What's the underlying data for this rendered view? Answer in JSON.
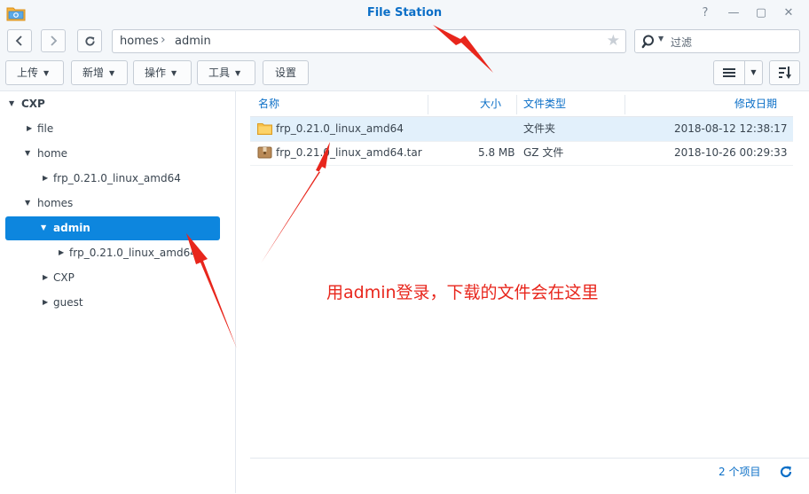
{
  "window": {
    "title": "File Station",
    "controls": [
      "?",
      "—",
      "▢",
      "✕"
    ]
  },
  "path": {
    "segments": [
      "homes",
      "admin"
    ]
  },
  "search": {
    "placeholder": "过滤"
  },
  "toolbar": {
    "upload": "上传",
    "create": "新增",
    "action": "操作",
    "tools": "工具",
    "settings": "设置"
  },
  "sidebar": {
    "items": [
      {
        "label": "CXP",
        "expanded": true
      },
      {
        "label": "file",
        "expanded": false
      },
      {
        "label": "home",
        "expanded": true
      },
      {
        "label": "frp_0.21.0_linux_amd64",
        "expanded": false
      },
      {
        "label": "homes",
        "expanded": true
      },
      {
        "label": "admin",
        "expanded": true,
        "selected": true
      },
      {
        "label": "frp_0.21.0_linux_amd64",
        "expanded": false
      },
      {
        "label": "CXP",
        "expanded": false
      },
      {
        "label": "guest",
        "expanded": false
      }
    ]
  },
  "table": {
    "columns": [
      "名称",
      "大小",
      "文件类型",
      "修改日期"
    ],
    "rows": [
      {
        "name": "frp_0.21.0_linux_amd64",
        "size": "",
        "type": "文件夹",
        "modified": "2018-08-12 12:38:17",
        "icon": "folder-icon",
        "selected": true
      },
      {
        "name": "frp_0.21.0_linux_amd64.tar",
        "size": "5.8 MB",
        "type": "GZ 文件",
        "modified": "2018-10-26 00:29:33",
        "icon": "archive-icon",
        "selected": false
      }
    ]
  },
  "status": {
    "count": "2 个项目"
  },
  "annotation": {
    "text": "用admin登录，下载的文件会在这里"
  },
  "colors": {
    "accent": "#0b6fc7",
    "selection": "#0d86de",
    "annotation": "#e8261c"
  }
}
